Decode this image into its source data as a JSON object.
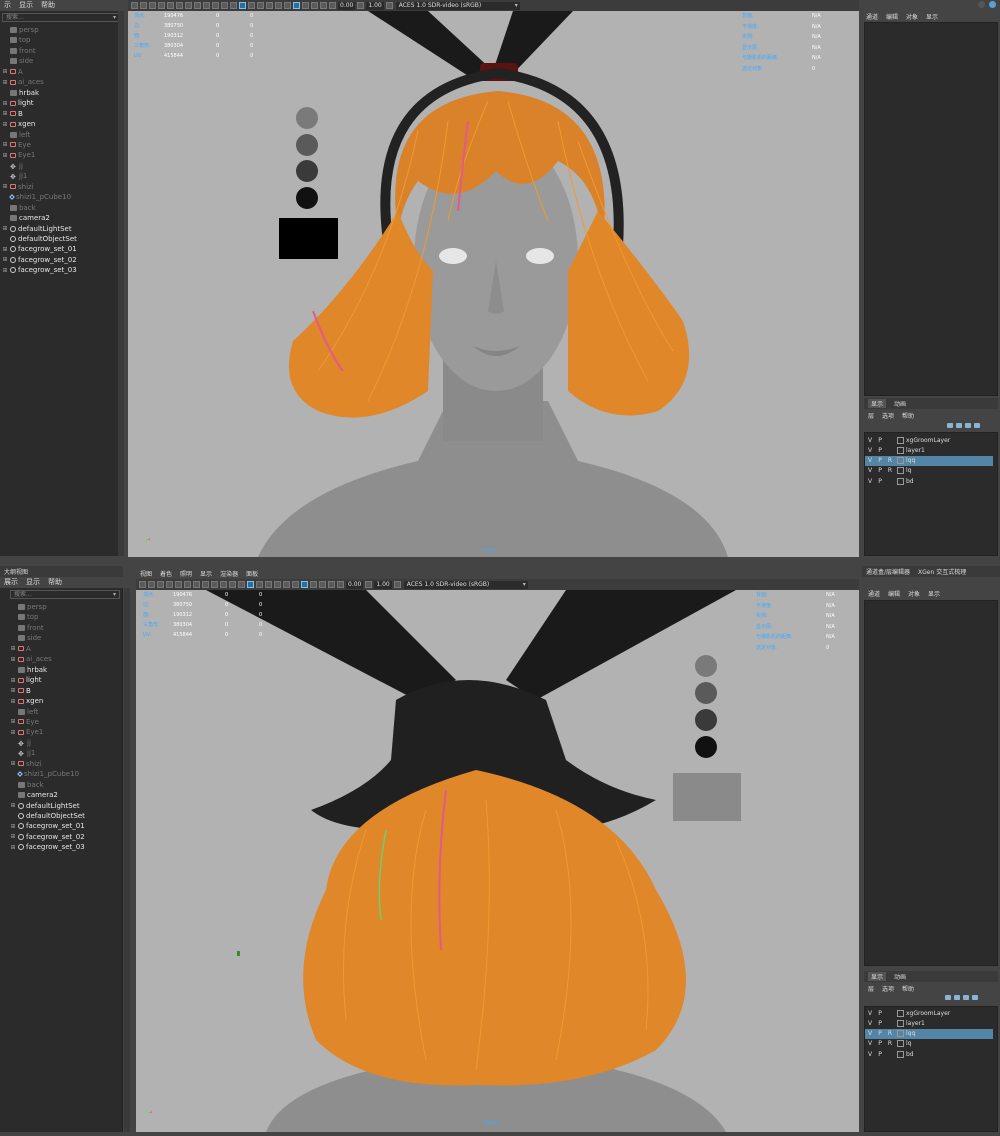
{
  "top": {
    "outliner_menu": [
      "示",
      "显示",
      "帮助"
    ],
    "search_placeholder": "搜索...",
    "items": [
      {
        "label": "persp",
        "icon": "camera-icon",
        "dim": true,
        "plus": false
      },
      {
        "label": "top",
        "icon": "camera-icon",
        "dim": true,
        "plus": false
      },
      {
        "label": "front",
        "icon": "camera-icon",
        "dim": true,
        "plus": false
      },
      {
        "label": "side",
        "icon": "camera-icon",
        "dim": true,
        "plus": false
      },
      {
        "label": "A",
        "icon": "group-icon",
        "dim": true,
        "plus": true
      },
      {
        "label": "ai_aces",
        "icon": "group-icon",
        "dim": true,
        "plus": true
      },
      {
        "label": "hrbak",
        "icon": "camera-icon",
        "dim": false,
        "plus": false
      },
      {
        "label": "light",
        "icon": "group-icon",
        "dim": false,
        "plus": true
      },
      {
        "label": "B",
        "icon": "group-icon",
        "dim": false,
        "plus": true
      },
      {
        "label": "xgen",
        "icon": "group-icon",
        "dim": false,
        "plus": true
      },
      {
        "label": "left",
        "icon": "camera-icon",
        "dim": true,
        "plus": false
      },
      {
        "label": "Eye",
        "icon": "group-icon",
        "dim": true,
        "plus": true
      },
      {
        "label": "Eye1",
        "icon": "group-icon",
        "dim": true,
        "plus": true
      },
      {
        "label": "jj",
        "icon": "locator-icon",
        "dim": true,
        "plus": false
      },
      {
        "label": "jj1",
        "icon": "locator-icon",
        "dim": true,
        "plus": false
      },
      {
        "label": "shizi",
        "icon": "group-icon",
        "dim": true,
        "plus": true
      },
      {
        "label": "shizi1_pCube10",
        "icon": "mesh-icon",
        "dim": true,
        "plus": false
      },
      {
        "label": "back",
        "icon": "camera-icon",
        "dim": true,
        "plus": false
      },
      {
        "label": "camera2",
        "icon": "camera-icon",
        "dim": false,
        "plus": false
      },
      {
        "label": "defaultLightSet",
        "icon": "set-icon",
        "dim": false,
        "plus": true
      },
      {
        "label": "defaultObjectSet",
        "icon": "set-icon",
        "dim": false,
        "plus": false
      },
      {
        "label": "facegrow_set_01",
        "icon": "set-icon",
        "dim": false,
        "plus": true
      },
      {
        "label": "facegrow_set_02",
        "icon": "set-icon",
        "dim": false,
        "plus": true
      },
      {
        "label": "facegrow_set_03",
        "icon": "set-icon",
        "dim": false,
        "plus": true
      }
    ],
    "toolbar": {
      "exposure": "0.00",
      "gamma": "1.00",
      "color_space": "ACES 1.0 SDR-video (sRGB)"
    },
    "hud_left": [
      {
        "label": "顶点:",
        "v1": "190476",
        "v2": "0",
        "v3": "0"
      },
      {
        "label": "边:",
        "v1": "380750",
        "v2": "0",
        "v3": "0"
      },
      {
        "label": "面:",
        "v1": "190312",
        "v2": "0",
        "v3": "0"
      },
      {
        "label": "三角形:",
        "v1": "380304",
        "v2": "0",
        "v3": "0"
      },
      {
        "label": "UV:",
        "v1": "415844",
        "v2": "0",
        "v3": "0"
      }
    ],
    "hud_right": [
      {
        "label": "背面:",
        "value": "N/A"
      },
      {
        "label": "平滑度:",
        "value": "N/A"
      },
      {
        "label": "实例:",
        "value": "N/A"
      },
      {
        "label": "显示层:",
        "value": "N/A"
      },
      {
        "label": "与摄影机的距离:",
        "value": "N/A"
      },
      {
        "label": "选定对象:",
        "value": "0"
      }
    ],
    "camera_name": "persp",
    "right_tabs": [
      "通道",
      "编辑",
      "对象",
      "显示"
    ],
    "layer_tabs": [
      "显示",
      "动画"
    ],
    "layer_menu": [
      "层",
      "选项",
      "帮助"
    ],
    "layers": [
      {
        "v": "V",
        "p": "P",
        "r": "",
        "name": "xgGroomLayer",
        "selected": false
      },
      {
        "v": "V",
        "p": "P",
        "r": "",
        "name": "layer1",
        "selected": false
      },
      {
        "v": "V",
        "p": "P",
        "r": "R",
        "name": "lqq",
        "selected": true
      },
      {
        "v": "V",
        "p": "P",
        "r": "R",
        "name": "lq",
        "selected": false
      },
      {
        "v": "V",
        "p": "P",
        "r": "",
        "name": "bd",
        "selected": false
      }
    ]
  },
  "bottom": {
    "title": "大纲视图",
    "outliner_menu": [
      "展示",
      "显示",
      "帮助"
    ],
    "search_placeholder": "搜索...",
    "viewport_menu": [
      "视图",
      "着色",
      "照明",
      "显示",
      "渲染器",
      "面板"
    ],
    "items": [
      {
        "label": "persp",
        "icon": "camera-icon",
        "dim": true,
        "plus": false
      },
      {
        "label": "top",
        "icon": "camera-icon",
        "dim": true,
        "plus": false
      },
      {
        "label": "front",
        "icon": "camera-icon",
        "dim": true,
        "plus": false
      },
      {
        "label": "side",
        "icon": "camera-icon",
        "dim": true,
        "plus": false
      },
      {
        "label": "A",
        "icon": "group-icon",
        "dim": true,
        "plus": true
      },
      {
        "label": "ai_aces",
        "icon": "group-icon",
        "dim": true,
        "plus": true
      },
      {
        "label": "hrbak",
        "icon": "camera-icon",
        "dim": false,
        "plus": false
      },
      {
        "label": "light",
        "icon": "group-icon",
        "dim": false,
        "plus": true
      },
      {
        "label": "B",
        "icon": "group-icon",
        "dim": false,
        "plus": true
      },
      {
        "label": "xgen",
        "icon": "group-icon",
        "dim": false,
        "plus": true
      },
      {
        "label": "left",
        "icon": "camera-icon",
        "dim": true,
        "plus": false
      },
      {
        "label": "Eye",
        "icon": "group-icon",
        "dim": true,
        "plus": true
      },
      {
        "label": "Eye1",
        "icon": "group-icon",
        "dim": true,
        "plus": true
      },
      {
        "label": "jj",
        "icon": "locator-icon",
        "dim": true,
        "plus": false
      },
      {
        "label": "jj1",
        "icon": "locator-icon",
        "dim": true,
        "plus": false
      },
      {
        "label": "shizi",
        "icon": "group-icon",
        "dim": true,
        "plus": true
      },
      {
        "label": "shizi1_pCube10",
        "icon": "mesh-icon",
        "dim": true,
        "plus": false
      },
      {
        "label": "back",
        "icon": "camera-icon",
        "dim": true,
        "plus": false
      },
      {
        "label": "camera2",
        "icon": "camera-icon",
        "dim": false,
        "plus": false
      },
      {
        "label": "defaultLightSet",
        "icon": "set-icon",
        "dim": false,
        "plus": true
      },
      {
        "label": "defaultObjectSet",
        "icon": "set-icon",
        "dim": false,
        "plus": false
      },
      {
        "label": "facegrow_set_01",
        "icon": "set-icon",
        "dim": false,
        "plus": true
      },
      {
        "label": "facegrow_set_02",
        "icon": "set-icon",
        "dim": false,
        "plus": true
      },
      {
        "label": "facegrow_set_03",
        "icon": "set-icon",
        "dim": false,
        "plus": true
      }
    ],
    "toolbar": {
      "exposure": "0.00",
      "gamma": "1.00",
      "color_space": "ACES 1.0 SDR-video (sRGB)"
    },
    "hud_left": [
      {
        "label": "顶点:",
        "v1": "190476",
        "v2": "0",
        "v3": "0"
      },
      {
        "label": "边:",
        "v1": "380750",
        "v2": "0",
        "v3": "0"
      },
      {
        "label": "面:",
        "v1": "190312",
        "v2": "0",
        "v3": "0"
      },
      {
        "label": "三角形:",
        "v1": "380304",
        "v2": "0",
        "v3": "0"
      },
      {
        "label": "UV:",
        "v1": "415844",
        "v2": "0",
        "v3": "0"
      }
    ],
    "hud_right": [
      {
        "label": "背面:",
        "value": "N/A"
      },
      {
        "label": "平滑度:",
        "value": "N/A"
      },
      {
        "label": "实例:",
        "value": "N/A"
      },
      {
        "label": "显示层:",
        "value": "N/A"
      },
      {
        "label": "与摄影机的距离:",
        "value": "N/A"
      },
      {
        "label": "选定对象:",
        "value": "0"
      }
    ],
    "camera_name": "persp",
    "right_title_tabs": [
      "通道盒/层编辑器",
      "XGen 交互式梳理"
    ],
    "right_tabs": [
      "通道",
      "编辑",
      "对象",
      "显示"
    ],
    "layer_tabs": [
      "显示",
      "动画"
    ],
    "layer_menu": [
      "层",
      "选项",
      "帮助"
    ],
    "layers": [
      {
        "v": "V",
        "p": "P",
        "r": "",
        "name": "xgGroomLayer",
        "selected": false
      },
      {
        "v": "V",
        "p": "P",
        "r": "",
        "name": "layer1",
        "selected": false
      },
      {
        "v": "V",
        "p": "P",
        "r": "R",
        "name": "lqq",
        "selected": true
      },
      {
        "v": "V",
        "p": "P",
        "r": "R",
        "name": "lq",
        "selected": false
      },
      {
        "v": "V",
        "p": "P",
        "r": "",
        "name": "bd",
        "selected": false
      }
    ]
  },
  "colors": {
    "hud_label": "#3fa9ff",
    "hair": "#e0872a",
    "selection": "#5285a6",
    "viewport_bg": "#b2b2b2"
  }
}
